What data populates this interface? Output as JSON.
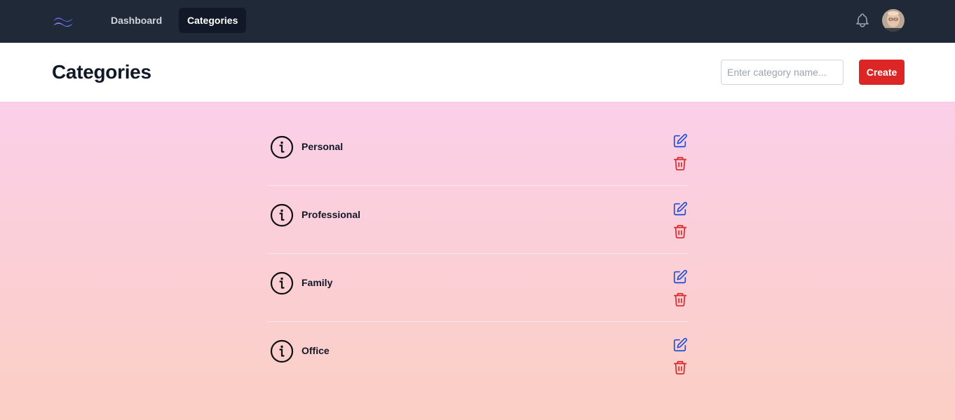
{
  "nav": {
    "logo_icon": "tailwind-waves-logo",
    "links": [
      {
        "label": "Dashboard",
        "active": false
      },
      {
        "label": "Categories",
        "active": true
      }
    ],
    "bell_icon": "bell-icon",
    "avatar_icon": "user-avatar"
  },
  "header": {
    "title": "Categories",
    "input_placeholder": "Enter category name...",
    "input_value": "",
    "create_label": "Create"
  },
  "categories": [
    {
      "name": "Personal"
    },
    {
      "name": "Professional"
    },
    {
      "name": "Family"
    },
    {
      "name": "Office"
    }
  ],
  "colors": {
    "nav_bg": "#1f2937",
    "accent_red": "#dc2626",
    "edit_blue": "#1d4ed8",
    "delete_red": "#dc2626",
    "bg_top": "#fbcfe8",
    "bg_bottom": "#fbcfc4"
  }
}
